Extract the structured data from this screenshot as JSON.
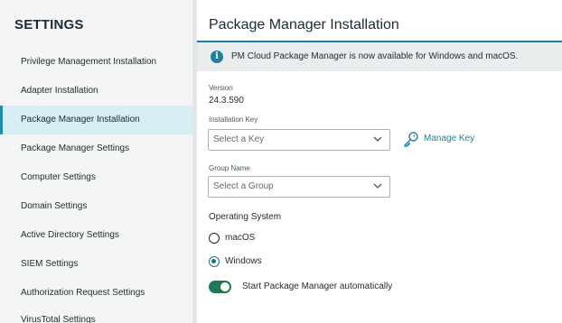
{
  "sidebar": {
    "title": "SETTINGS",
    "items": [
      {
        "label": "Privilege Management Installation"
      },
      {
        "label": "Adapter Installation"
      },
      {
        "label": "Package Manager Installation",
        "active": true
      },
      {
        "label": "Package Manager Settings"
      },
      {
        "label": "Computer Settings"
      },
      {
        "label": "Domain Settings"
      },
      {
        "label": "Active Directory Settings"
      },
      {
        "label": "SIEM Settings"
      },
      {
        "label": "Authorization Request Settings"
      },
      {
        "label": "VirusTotal Settings"
      }
    ]
  },
  "main": {
    "title": "Package Manager Installation",
    "banner": {
      "icon": "info-icon",
      "text": "PM Cloud Package Manager is now available for Windows and macOS."
    },
    "version": {
      "label": "Version",
      "value": "24.3.590"
    },
    "installation_key": {
      "label": "Installation Key",
      "placeholder": "Select a Key",
      "manage_key_label": "Manage Key",
      "manage_key_icon": "key-icon"
    },
    "group_name": {
      "label": "Group Name",
      "placeholder": "Select a Group"
    },
    "operating_system": {
      "label": "Operating System",
      "options": [
        {
          "label": "macOS",
          "checked": false
        },
        {
          "label": "Windows",
          "checked": true
        }
      ]
    },
    "auto_start": {
      "label": "Start Package Manager automatically",
      "enabled": true
    }
  },
  "colors": {
    "accent": "#1f7f9e",
    "active_item_bg": "#d6eef4",
    "toggle_on": "#1f7a52",
    "banner_bg": "#eaedee",
    "sidebar_bg": "#f4f5f5"
  }
}
